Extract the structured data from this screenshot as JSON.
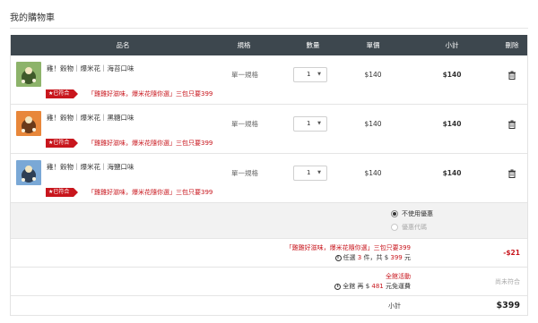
{
  "page": {
    "title": "我的購物車"
  },
  "table": {
    "headers": [
      "品名",
      "規格",
      "數量",
      "單價",
      "小計",
      "刪除"
    ]
  },
  "items": [
    {
      "name": "雞！穀物｜爆米花｜海苔口味",
      "spec": "單一規格",
      "qty": "1",
      "unit_price": "$140",
      "subtotal": "$140",
      "tag": "已符合",
      "promo_text": "「雞雞好滋味，爆米花隨你選」三包只要399",
      "thumb_color": "#7fa15a"
    },
    {
      "name": "雞！穀物｜爆米花｜黑糖口味",
      "spec": "單一規格",
      "qty": "1",
      "unit_price": "$140",
      "subtotal": "$140",
      "tag": "已符合",
      "promo_text": "「雞雞好滋味，爆米花隨你選」三包只要399",
      "thumb_color": "#e07a2a"
    },
    {
      "name": "雞！穀物｜爆米花｜海鹽口味",
      "spec": "單一規格",
      "qty": "1",
      "unit_price": "$140",
      "subtotal": "$140",
      "tag": "已符合",
      "promo_text": "「雞雞好滋味，爆米花隨你選」三包只要399",
      "thumb_color": "#6f9fcf"
    }
  ],
  "coupon": {
    "option_none": "不使用優惠",
    "option_code": "優惠代碼"
  },
  "promotions": [
    {
      "title": "「雞雞好滋味，爆米花隨你選」三包只要399",
      "detail_prefix": "任選",
      "count": "3",
      "detail_mid": "件，共 $",
      "amount": "399",
      "detail_suffix": "元",
      "discount": "-$21",
      "info_symbol": "i"
    },
    {
      "title": "全館活動",
      "detail_prefix": "全館 再 $",
      "amount": "481",
      "detail_suffix": "元免運費",
      "status": "尚未符合",
      "info_symbol": "i"
    }
  ],
  "summary": {
    "label": "小計",
    "total": "$399"
  },
  "colors": {
    "header_bg": "#3d474e",
    "accent_red": "#c8161d",
    "coupon_bg": "#f2f2f2"
  }
}
